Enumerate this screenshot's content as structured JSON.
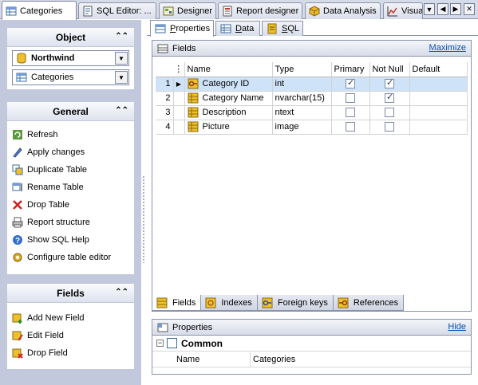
{
  "doc_tabs": [
    {
      "label": "Categories",
      "icon": "table-icon"
    },
    {
      "label": "SQL Editor: ...",
      "icon": "sql-editor-icon"
    },
    {
      "label": "Designer",
      "icon": "designer-icon"
    },
    {
      "label": "Report designer",
      "icon": "report-designer-icon"
    },
    {
      "label": "Data Analysis",
      "icon": "data-analysis-icon"
    },
    {
      "label": "Visua",
      "icon": "visual-chart-icon"
    }
  ],
  "object_panel": {
    "title": "Object",
    "database": "Northwind",
    "table": "Categories"
  },
  "general_panel": {
    "title": "General",
    "actions": [
      "Refresh",
      "Apply changes",
      "Duplicate Table",
      "Rename Table",
      "Drop Table",
      "Report structure",
      "Show SQL Help",
      "Configure table editor"
    ]
  },
  "fields_panel": {
    "title": "Fields",
    "actions": [
      "Add New Field",
      "Edit Field",
      "Drop Field"
    ]
  },
  "sub_tabs": [
    "Properties",
    "Data",
    "SQL"
  ],
  "fields_section": {
    "title": "Fields",
    "maximize_label": "Maximize",
    "columns": [
      "Name",
      "Type",
      "Primary",
      "Not Null",
      "Default"
    ],
    "rows": [
      {
        "num": "1",
        "name": "Category ID",
        "type": "int",
        "primary": true,
        "not_null": true,
        "default": ""
      },
      {
        "num": "2",
        "name": "Category Name",
        "type": "nvarchar(15)",
        "primary": false,
        "not_null": true,
        "default": ""
      },
      {
        "num": "3",
        "name": "Description",
        "type": "ntext",
        "primary": false,
        "not_null": false,
        "default": ""
      },
      {
        "num": "4",
        "name": "Picture",
        "type": "image",
        "primary": false,
        "not_null": false,
        "default": ""
      }
    ]
  },
  "bottom_tabs": [
    "Fields",
    "Indexes",
    "Foreign keys",
    "References"
  ],
  "properties_section": {
    "title": "Properties",
    "hide_label": "Hide",
    "group": "Common",
    "rows": [
      {
        "name": "Name",
        "value": "Categories"
      }
    ]
  }
}
